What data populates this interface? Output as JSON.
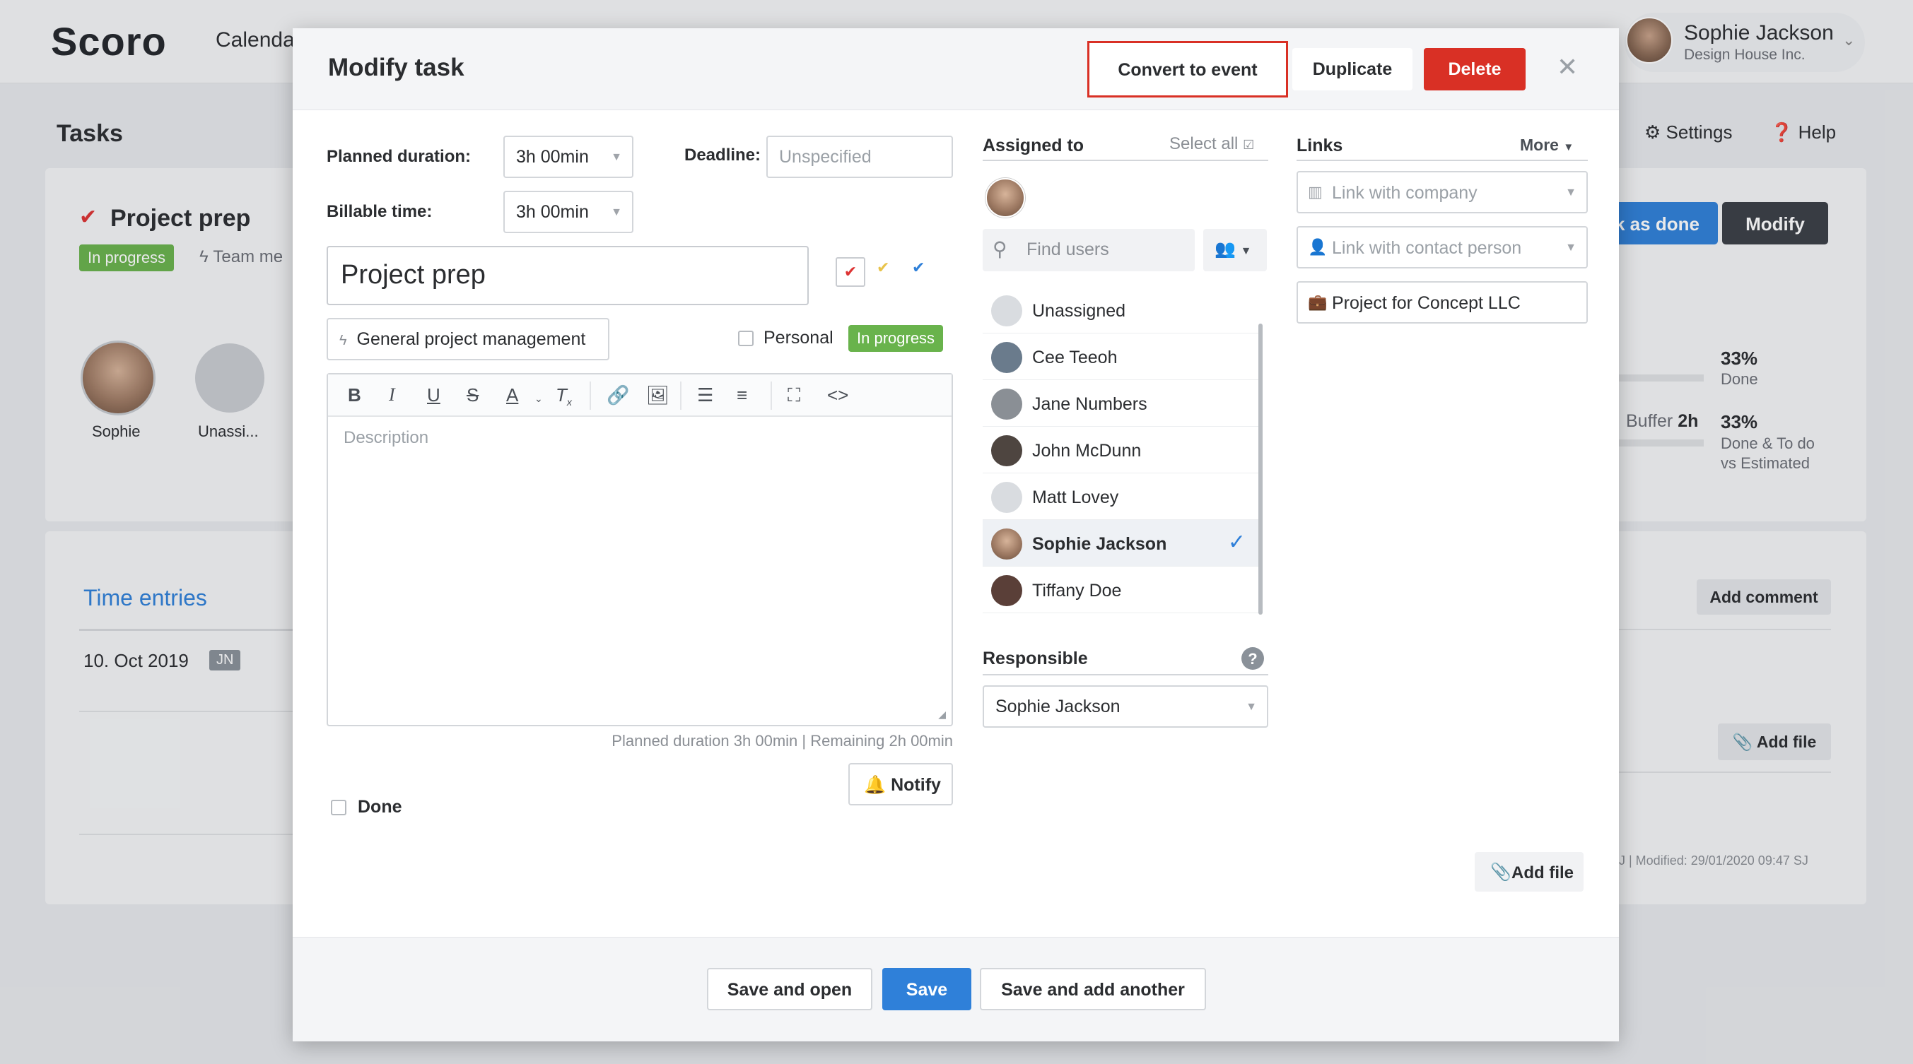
{
  "app": {
    "logo": "Scoro",
    "nav_calendar": "Calenda"
  },
  "user": {
    "name": "Sophie Jackson",
    "org": "Design House Inc."
  },
  "page": {
    "title": "Tasks",
    "settings": "Settings",
    "help": "Help"
  },
  "task_bg": {
    "title": "Project prep",
    "status": "In progress",
    "team": "Team me",
    "avatars": [
      "Sophie",
      "Unassi..."
    ],
    "done_btn": "k as done",
    "modify_btn": "Modify",
    "stat1_pct": "33%",
    "stat1_lbl": "Done",
    "buffer_lbl": "Buffer",
    "buffer_val": "2h",
    "stat2_pct": "33%",
    "stat2_lbl1": "Done & To do",
    "stat2_lbl2": "vs Estimated",
    "time_entries": "Time entries",
    "te_date": "10. Oct 2019",
    "te_user": "JN",
    "add_comment": "Add comment",
    "add_file": "Add file",
    "modified": "J | Modified: 29/01/2020 09:47 SJ"
  },
  "modal": {
    "title": "Modify task",
    "buttons": {
      "convert": "Convert to event",
      "duplicate": "Duplicate",
      "delete": "Delete",
      "close": "✕"
    },
    "planned_label": "Planned duration:",
    "planned_value": "3h 00min",
    "deadline_label": "Deadline:",
    "deadline_placeholder": "Unspecified",
    "billable_label": "Billable time:",
    "billable_value": "3h 00min",
    "task_name": "Project prep",
    "project": "General project management",
    "personal_label": "Personal",
    "status": "In progress",
    "description_placeholder": "Description",
    "meta": "Planned duration 3h 00min | Remaining 2h 00min",
    "notify": "Notify",
    "done_label": "Done",
    "assigned_label": "Assigned to",
    "select_all": "Select all",
    "find_placeholder": "Find users",
    "users": [
      {
        "name": "Unassigned",
        "selected": false
      },
      {
        "name": "Cee Teeoh",
        "selected": false
      },
      {
        "name": "Jane Numbers",
        "selected": false
      },
      {
        "name": "John McDunn",
        "selected": false
      },
      {
        "name": "Matt Lovey",
        "selected": false
      },
      {
        "name": "Sophie Jackson",
        "selected": true
      },
      {
        "name": "Tiffany Doe",
        "selected": false
      }
    ],
    "responsible_label": "Responsible",
    "responsible_value": "Sophie Jackson",
    "links_label": "Links",
    "more": "More",
    "link_company_placeholder": "Link with company",
    "link_contact_placeholder": "Link with contact person",
    "link_project": "Project for Concept LLC",
    "add_file": "Add file",
    "footer": {
      "save_open": "Save and open",
      "save": "Save",
      "save_add": "Save and add another"
    }
  },
  "colors": {
    "accent": "#2f80d9",
    "danger": "#d93025",
    "status_green": "#69b34c"
  }
}
